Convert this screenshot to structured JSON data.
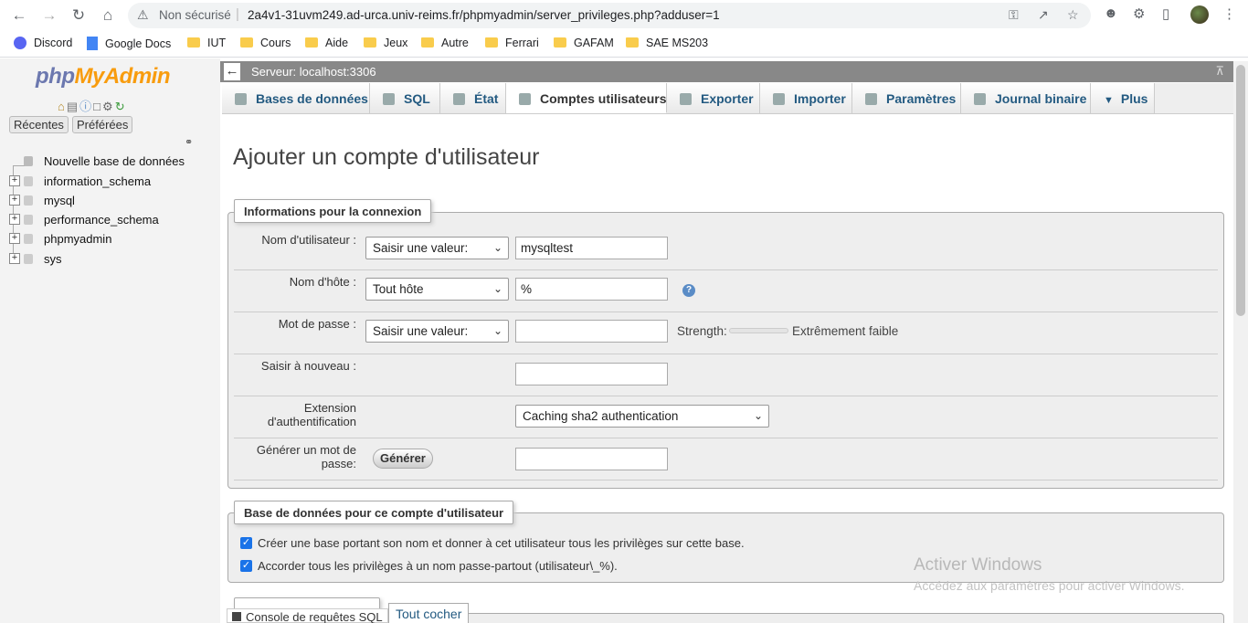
{
  "browser": {
    "insecure_label": "Non sécurisé",
    "url": "2a4v1-31uvm249.ad-urca.univ-reims.fr/phpmyadmin/server_privileges.php?adduser=1",
    "bookmarks": [
      {
        "label": "Discord",
        "icon": "discord-icon"
      },
      {
        "label": "Google Docs",
        "icon": "google-docs-icon"
      },
      {
        "label": "IUT",
        "icon": "folder-icon"
      },
      {
        "label": "Cours",
        "icon": "folder-icon"
      },
      {
        "label": "Aide",
        "icon": "folder-icon"
      },
      {
        "label": "Jeux",
        "icon": "folder-icon"
      },
      {
        "label": "Autre",
        "icon": "folder-icon"
      },
      {
        "label": "Ferrari",
        "icon": "folder-icon"
      },
      {
        "label": "GAFAM",
        "icon": "folder-icon"
      },
      {
        "label": "SAE MS203",
        "icon": "folder-icon"
      }
    ]
  },
  "navigation": {
    "logo_php": "php",
    "logo_my": "MyAdmin",
    "recent_label": "Récentes",
    "favorites_label": "Préférées",
    "new_db_label": "Nouvelle base de données",
    "databases": [
      "information_schema",
      "mysql",
      "performance_schema",
      "phpmyadmin",
      "sys"
    ]
  },
  "server": {
    "label": "Serveur: localhost:3306"
  },
  "tabs": [
    {
      "label": "Bases de données",
      "active": false
    },
    {
      "label": "SQL",
      "active": false
    },
    {
      "label": "État",
      "active": false
    },
    {
      "label": "Comptes utilisateurs",
      "active": true
    },
    {
      "label": "Exporter",
      "active": false
    },
    {
      "label": "Importer",
      "active": false
    },
    {
      "label": "Paramètres",
      "active": false
    },
    {
      "label": "Journal binaire",
      "active": false
    },
    {
      "label": "Plus",
      "active": false
    }
  ],
  "page": {
    "title": "Ajouter un compte d'utilisateur"
  },
  "login_info": {
    "legend": "Informations pour la connexion",
    "username_label": "Nom d'utilisateur :",
    "username_select": "Saisir une valeur:",
    "username_value": "mysqltest",
    "host_label": "Nom d'hôte :",
    "host_select": "Tout hôte",
    "host_value": "%",
    "password_label": "Mot de passe :",
    "password_select": "Saisir une valeur:",
    "password_value": "",
    "strength_label": "Strength:",
    "strength_value": "Extrêmement faible",
    "retype_label": "Saisir à nouveau :",
    "auth_label_line1": "Extension",
    "auth_label_line2": "d'authentification",
    "auth_value": "Caching sha2 authentication",
    "generate_label_line1": "Générer un mot de",
    "generate_label_line2": "passe:",
    "generate_button": "Générer"
  },
  "database_section": {
    "legend": "Base de données pour ce compte d'utilisateur",
    "option1": "Créer une base portant son nom et donner à cet utilisateur tous les privilèges sur cette base.",
    "option1_checked": true,
    "option2": "Accorder tous les privilèges à un nom passe-partout (utilisateur\\_%).",
    "option2_checked": true
  },
  "bottom": {
    "console_label": "Console de requêtes SQL",
    "check_all_label": "Tout cocher"
  },
  "watermark": {
    "line1": "Activer Windows",
    "line2": "Accédez aux paramètres pour activer Windows."
  }
}
